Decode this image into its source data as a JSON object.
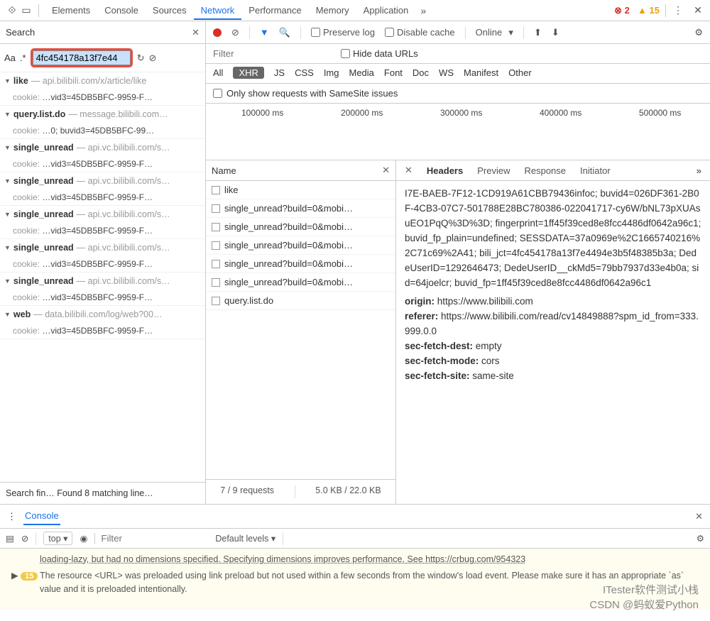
{
  "topTabs": {
    "items": [
      "Elements",
      "Console",
      "Sources",
      "Network",
      "Performance",
      "Memory",
      "Application"
    ],
    "active": "Network",
    "errors": "2",
    "warnings": "15"
  },
  "search": {
    "title": "Search",
    "input": "4fc454178a13f7e44",
    "aa": "Aa",
    "regex": ".*",
    "footer": "Search fin…  Found 8 matching line…",
    "results": [
      {
        "name": "like",
        "host": "api.bilibili.com/x/article/like",
        "key": "cookie:",
        "val": "…vid3=45DB5BFC-9959-F…"
      },
      {
        "name": "query.list.do",
        "host": "message.bilibili.com…",
        "key": "cookie:",
        "val": "…0; buvid3=45DB5BFC-99…"
      },
      {
        "name": "single_unread",
        "host": "api.vc.bilibili.com/s…",
        "key": "cookie:",
        "val": "…vid3=45DB5BFC-9959-F…"
      },
      {
        "name": "single_unread",
        "host": "api.vc.bilibili.com/s…",
        "key": "cookie:",
        "val": "…vid3=45DB5BFC-9959-F…"
      },
      {
        "name": "single_unread",
        "host": "api.vc.bilibili.com/s…",
        "key": "cookie:",
        "val": "…vid3=45DB5BFC-9959-F…"
      },
      {
        "name": "single_unread",
        "host": "api.vc.bilibili.com/s…",
        "key": "cookie:",
        "val": "…vid3=45DB5BFC-9959-F…"
      },
      {
        "name": "single_unread",
        "host": "api.vc.bilibili.com/s…",
        "key": "cookie:",
        "val": "…vid3=45DB5BFC-9959-F…"
      },
      {
        "name": "web",
        "host": "data.bilibili.com/log/web?00…",
        "key": "cookie:",
        "val": "…vid3=45DB5BFC-9959-F…"
      }
    ]
  },
  "toolbar": {
    "preserve": "Preserve log",
    "disable": "Disable cache",
    "throttle": "Online"
  },
  "filter": {
    "placeholder": "Filter",
    "hide": "Hide data URLs",
    "samesite": "Only show requests with SameSite issues",
    "types": [
      "All",
      "XHR",
      "JS",
      "CSS",
      "Img",
      "Media",
      "Font",
      "Doc",
      "WS",
      "Manifest",
      "Other"
    ],
    "active": "XHR"
  },
  "timeline": {
    "ticks": [
      "100000 ms",
      "200000 ms",
      "300000 ms",
      "400000 ms",
      "500000 ms"
    ]
  },
  "names": {
    "header": "Name",
    "rows": [
      "like",
      "single_unread?build=0&mobi…",
      "single_unread?build=0&mobi…",
      "single_unread?build=0&mobi…",
      "single_unread?build=0&mobi…",
      "single_unread?build=0&mobi…",
      "query.list.do"
    ],
    "footer": {
      "req": "7 / 9 requests",
      "size": "5.0 KB / 22.0 KB"
    }
  },
  "details": {
    "tabs": [
      "Headers",
      "Preview",
      "Response",
      "Initiator"
    ],
    "active": "Headers",
    "raw": "I7E-BAEB-7F12-1CD919A61CBB79436infoc; buvid4=026DF361-2B0F-4CB3-07C7-501788E28BC780386-022041717-cy6W/bNL73pXUAsuEO1PqQ%3D%3D; fingerprint=1ff45f39ced8e8fcc4486df0642a96c1; buvid_fp_plain=undefined; SESSDATA=37a0969e%2C1665740216%2C71c69%2A41; bili_jct=4fc454178a13f7e4494e3b5f48385b3a; DedeUserID=1292646473; DedeUserID__ckMd5=79bb7937d33e4b0a; sid=64joelcr; buvid_fp=1ff45f39ced8e8fcc4486df0642a96c1",
    "hdrs": [
      {
        "k": "origin:",
        "v": "https://www.bilibili.com"
      },
      {
        "k": "referer:",
        "v": "https://www.bilibili.com/read/cv14849888?spm_id_from=333.999.0.0"
      },
      {
        "k": "sec-fetch-dest:",
        "v": "empty"
      },
      {
        "k": "sec-fetch-mode:",
        "v": "cors"
      },
      {
        "k": "sec-fetch-site:",
        "v": "same-site"
      }
    ]
  },
  "console": {
    "title": "Console",
    "context": "top",
    "filter": "Filter",
    "levels": "Default levels ▾",
    "line1": "loading-lazy, but had no dimensions specified. Specifying dimensions improves performance. See https://crbug.com/954323",
    "warnCount": "15",
    "line2": "The resource <URL> was preloaded using link preload but not used within a few seconds from the window's load event. Please make sure it has an appropriate `as` value and it is preloaded intentionally."
  },
  "watermark": {
    "l1": "ITester软件测试小栈",
    "l2": "CSDN @蚂蚁爱Python"
  }
}
